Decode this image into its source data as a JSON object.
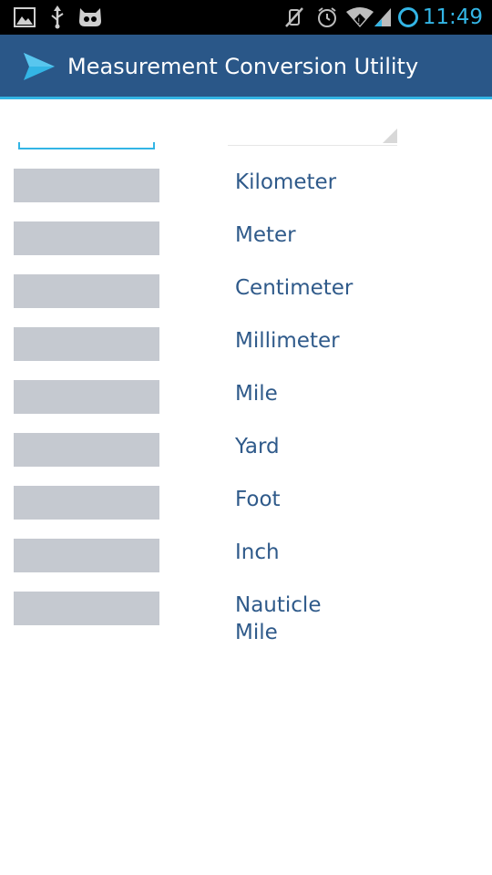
{
  "status_bar": {
    "time": "11:49",
    "icons": [
      "image-icon",
      "usb-icon",
      "cyanogen-mascot-icon",
      "mute-icon",
      "alarm-icon",
      "wifi-icon",
      "signal-icon",
      "battery-icon"
    ],
    "accent_color": "#33b5e5"
  },
  "action_bar": {
    "title": "Measurement Conversion Utility",
    "icon": "send-arrow-icon",
    "background": "#2a5788"
  },
  "input": {
    "value": "",
    "placeholder": ""
  },
  "spinner": {
    "selected": ""
  },
  "units": [
    {
      "label": "Kilometer",
      "value": ""
    },
    {
      "label": "Meter",
      "value": ""
    },
    {
      "label": "Centimeter",
      "value": ""
    },
    {
      "label": "Millimeter",
      "value": ""
    },
    {
      "label": "Mile",
      "value": ""
    },
    {
      "label": "Yard",
      "value": ""
    },
    {
      "label": "Foot",
      "value": ""
    },
    {
      "label": "Inch",
      "value": ""
    },
    {
      "label": "Nauticle Mile",
      "value": ""
    }
  ]
}
